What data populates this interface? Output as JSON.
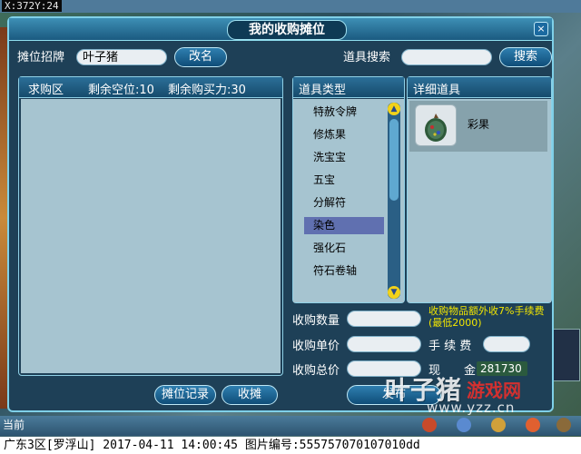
{
  "hud": {
    "coords": "X:372Y:24",
    "chat_label": "当前"
  },
  "dialog": {
    "title": "我的收购摊位",
    "close_glyph": "×",
    "stall_sign_label": "摊位招牌",
    "stall_sign_value": "叶子猪",
    "rename_button": "改名",
    "item_search_label": "道具搜索",
    "item_search_value": "",
    "search_button": "搜索",
    "purchase_panel": {
      "title": "求购区",
      "remaining_slots": "剩余空位:10",
      "remaining_power": "剩余购买力:30"
    },
    "category_panel": {
      "title": "道具类型",
      "items": [
        "特赦令牌",
        "修炼果",
        "洗宝宝",
        "五宝",
        "分解符",
        "染色",
        "强化石",
        "符石卷轴"
      ],
      "selected_index": 5,
      "up_glyph": "▲",
      "down_glyph": "▼"
    },
    "detail_panel": {
      "title": "详细道具",
      "item_name": "彩果",
      "item_icon": "fruit-icon"
    },
    "form": {
      "qty_label": "收购数量",
      "unit_price_label": "收购单价",
      "total_price_label": "收购总价",
      "fee_note_line1": "收购物品额外收7%手续费",
      "fee_note_line2": "(最低2000)",
      "fee_label": "手 续 费",
      "cash_label_1": "现",
      "cash_label_2": "金",
      "cash_value": "281730"
    },
    "buttons": {
      "stall_record": "摊位记录",
      "close_stall": "收摊",
      "publish": "发布"
    }
  },
  "watermark": {
    "brand": "叶子猪",
    "site": "游戏网",
    "url": "www.yzz.cn"
  },
  "caption": "广东3区[罗浮山] 2017-04-11 14:00:45 图片编号:555757070107010dd",
  "colors": {
    "panel_bg": "#a6c4d0",
    "selected_bg": "#6070b0",
    "note_yellow": "#f2e600",
    "frame": "#1e4057"
  }
}
